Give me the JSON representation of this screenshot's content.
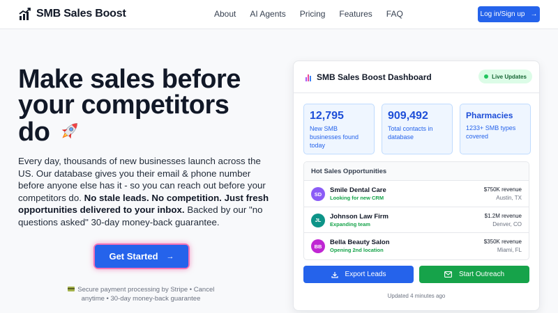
{
  "brand": {
    "name": "SMB Sales Boost",
    "icon": "bar-chart-trend-icon"
  },
  "nav": {
    "items": [
      "About",
      "AI Agents",
      "Pricing",
      "Features",
      "FAQ"
    ]
  },
  "header": {
    "login_label": "Log in/Sign up",
    "login_icon": "arrow-right-icon"
  },
  "hero": {
    "title_line1": "Make sales before",
    "title_line2": "your competitors",
    "title_line3": "do",
    "title_emoji": "rocket-icon",
    "text_part1": "Every day, thousands of new businesses launch across the US. Our database gives you their email & phone number before anyone else has it - so you can reach out before your competitors do. ",
    "text_bold": "No stale leads. No competition. Just fresh opportunities delivered to your inbox.",
    "text_part2": " Backed by our \"no questions asked\" 30-day money-back guarantee.",
    "cta_label": "Get Started",
    "secure_line1": "Secure payment processing by Stripe • Cancel",
    "secure_line2": "anytime • 30-day money-back guarantee"
  },
  "dashboard": {
    "title": "SMB Sales Boost Dashboard",
    "live_label": "Live Updates",
    "stats": [
      {
        "value": "12,795",
        "label_1": "New SMB",
        "label_2": "businesses found",
        "label_3": "today"
      },
      {
        "value": "909,492",
        "label_1": "Total contacts in",
        "label_2": "database"
      },
      {
        "value": "Pharmacies",
        "label_1": "1233+ SMB types",
        "label_2": "covered"
      }
    ],
    "opportunities_title": "Hot Sales Opportunities",
    "opportunities": [
      {
        "initials": "SD",
        "name": "Smile Dental Care",
        "note": "Looking for new CRM",
        "revenue": "$750K revenue",
        "location": "Austin, TX",
        "color": "#8b5cf6"
      },
      {
        "initials": "JL",
        "name": "Johnson Law Firm",
        "note": "Expanding team",
        "revenue": "$1.2M revenue",
        "location": "Denver, CO",
        "color": "#0d9488"
      },
      {
        "initials": "BB",
        "name": "Bella Beauty Salon",
        "note": "Opening 2nd location",
        "revenue": "$350K revenue",
        "location": "Miami, FL",
        "color": "#c026d3"
      }
    ],
    "export_label": "Export Leads",
    "outreach_label": "Start Outreach",
    "updated_label": "Updated 4 minutes ago"
  },
  "colors": {
    "primary": "#2563eb",
    "success": "#16a34a",
    "cta_glow": "#ec4899"
  }
}
